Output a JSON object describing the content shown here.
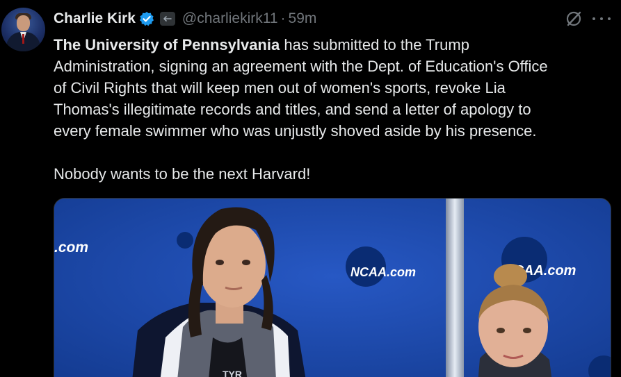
{
  "author": {
    "name": "Charlie Kirk",
    "handle": "@charliekirk11",
    "separator": "·",
    "time": "59m",
    "verified_color": "#1d9bf0"
  },
  "icons": {
    "verified": "verified-badge-icon",
    "affiliation": "affiliation-badge-icon",
    "grok": "grok-icon",
    "more": "more-options-icon"
  },
  "tweet": {
    "line1_bold": "The University of Pennsylvania",
    "line1_rest": " has submitted to the Trump",
    "line2": "Administration, signing an agreement with the Dept. of Education's Office",
    "line3": "of Civil Rights that will keep men out of women's sports, revoke Lia",
    "line4": "Thomas's illegitimate records and titles, and send a letter of apology to",
    "line5": "every female swimmer who was unjustly shoved aside by his presence.",
    "line6": "Nobody wants to be the next Harvard!"
  },
  "media": {
    "backdrop_text_left": ".com",
    "logo1": "NCAA.com",
    "logo2": "NCAA.com",
    "swimsuit_logo": "TYR",
    "backdrop_color": "#1947a8"
  }
}
